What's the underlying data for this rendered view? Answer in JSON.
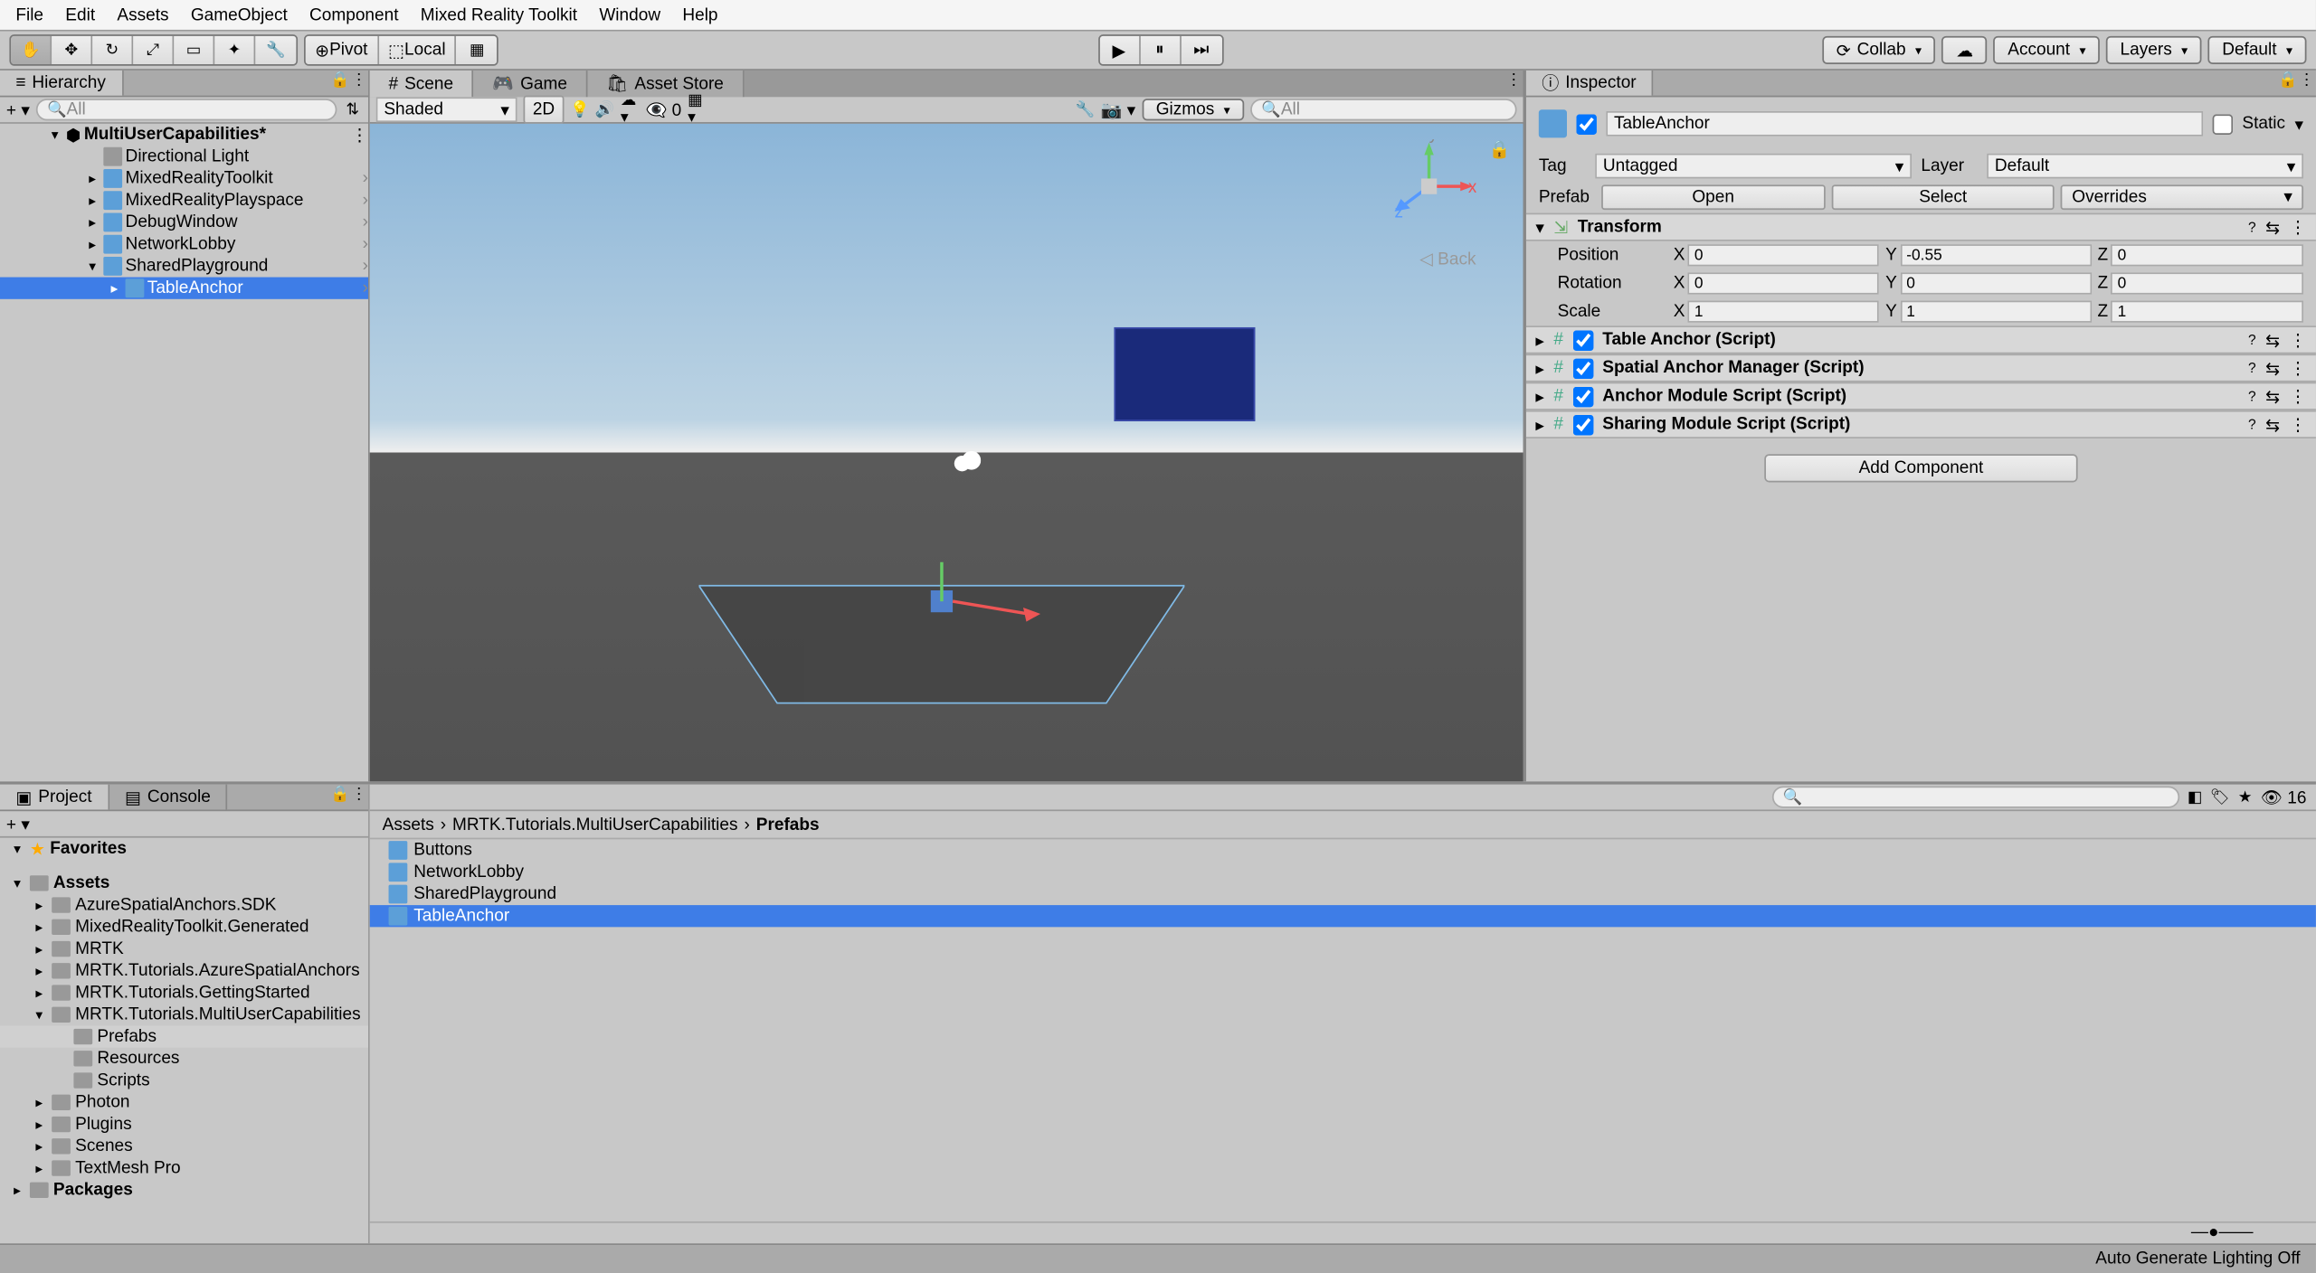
{
  "menubar": [
    "File",
    "Edit",
    "Assets",
    "GameObject",
    "Component",
    "Mixed Reality Toolkit",
    "Window",
    "Help"
  ],
  "toolbar": {
    "pivot": "Pivot",
    "local": "Local",
    "collab": "Collab",
    "account": "Account",
    "layers": "Layers",
    "layout": "Default"
  },
  "hierarchy": {
    "tab": "Hierarchy",
    "search_placeholder": "All",
    "root": "MultiUserCapabilities*",
    "items": [
      {
        "name": "Directional Light",
        "indent": 1,
        "icon": "gray"
      },
      {
        "name": "MixedRealityToolkit",
        "indent": 1,
        "arrow": "▸"
      },
      {
        "name": "MixedRealityPlayspace",
        "indent": 1,
        "arrow": "▸"
      },
      {
        "name": "DebugWindow",
        "indent": 1,
        "arrow": "▸",
        "icon": "blue"
      },
      {
        "name": "NetworkLobby",
        "indent": 1,
        "arrow": "▸",
        "icon": "blue"
      },
      {
        "name": "SharedPlayground",
        "indent": 1,
        "arrow": "▾",
        "icon": "blue"
      },
      {
        "name": "TableAnchor",
        "indent": 2,
        "arrow": "▸",
        "icon": "blue",
        "selected": true
      }
    ]
  },
  "scene": {
    "tabs": [
      {
        "label": "Scene",
        "active": true
      },
      {
        "label": "Game"
      },
      {
        "label": "Asset Store"
      }
    ],
    "shading": "Shaded",
    "mode_2d": "2D",
    "hidden_count": "0",
    "gizmos": "Gizmos",
    "search_placeholder": "All",
    "back": "Back",
    "axes": {
      "x": "x",
      "y": "y",
      "z": "z"
    }
  },
  "inspector": {
    "tab": "Inspector",
    "name": "TableAnchor",
    "static": "Static",
    "tag_label": "Tag",
    "tag_value": "Untagged",
    "layer_label": "Layer",
    "layer_value": "Default",
    "prefab_label": "Prefab",
    "prefab_open": "Open",
    "prefab_select": "Select",
    "prefab_overrides": "Overrides",
    "transform": {
      "title": "Transform",
      "position": {
        "label": "Position",
        "x": "0",
        "y": "-0.55",
        "z": "0"
      },
      "rotation": {
        "label": "Rotation",
        "x": "0",
        "y": "0",
        "z": "0"
      },
      "scale": {
        "label": "Scale",
        "x": "1",
        "y": "1",
        "z": "1"
      }
    },
    "components": [
      "Table Anchor (Script)",
      "Spatial Anchor Manager (Script)",
      "Anchor Module Script (Script)",
      "Sharing Module Script (Script)"
    ],
    "add_component": "Add Component"
  },
  "project": {
    "tabs": [
      {
        "label": "Project",
        "active": true
      },
      {
        "label": "Console"
      }
    ],
    "count": "16",
    "favorites": "Favorites",
    "tree": [
      {
        "name": "Assets",
        "indent": 0,
        "arrow": "▾",
        "bold": true
      },
      {
        "name": "AzureSpatialAnchors.SDK",
        "indent": 1,
        "arrow": "▸"
      },
      {
        "name": "MixedRealityToolkit.Generated",
        "indent": 1,
        "arrow": "▸"
      },
      {
        "name": "MRTK",
        "indent": 1,
        "arrow": "▸"
      },
      {
        "name": "MRTK.Tutorials.AzureSpatialAnchors",
        "indent": 1,
        "arrow": "▸"
      },
      {
        "name": "MRTK.Tutorials.GettingStarted",
        "indent": 1,
        "arrow": "▸"
      },
      {
        "name": "MRTK.Tutorials.MultiUserCapabilities",
        "indent": 1,
        "arrow": "▾"
      },
      {
        "name": "Prefabs",
        "indent": 2,
        "selected": true
      },
      {
        "name": "Resources",
        "indent": 2
      },
      {
        "name": "Scripts",
        "indent": 2
      },
      {
        "name": "Photon",
        "indent": 1,
        "arrow": "▸"
      },
      {
        "name": "Plugins",
        "indent": 1,
        "arrow": "▸"
      },
      {
        "name": "Scenes",
        "indent": 1,
        "arrow": "▸"
      },
      {
        "name": "TextMesh Pro",
        "indent": 1,
        "arrow": "▸"
      },
      {
        "name": "Packages",
        "indent": 0,
        "arrow": "▸",
        "bold": true
      }
    ],
    "breadcrumb": [
      "Assets",
      "MRTK.Tutorials.MultiUserCapabilities",
      "Prefabs"
    ],
    "assets": [
      {
        "name": "Buttons"
      },
      {
        "name": "NetworkLobby"
      },
      {
        "name": "SharedPlayground"
      },
      {
        "name": "TableAnchor",
        "selected": true
      }
    ]
  },
  "statusbar": "Auto Generate Lighting Off"
}
